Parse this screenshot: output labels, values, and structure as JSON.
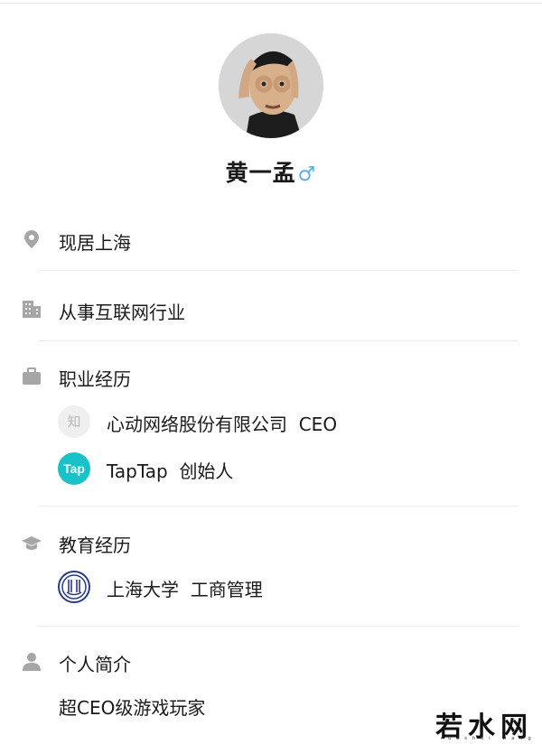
{
  "profile": {
    "name": "黄一孟",
    "gender_symbol": "♂"
  },
  "location": {
    "text": "现居上海",
    "icon": "location-pin-icon"
  },
  "industry": {
    "text": "从事互联网行业",
    "icon": "building-icon"
  },
  "career": {
    "title": "职业经历",
    "icon": "briefcase-icon",
    "items": [
      {
        "org": "心动网络股份有限公司",
        "role": "CEO",
        "logo_text": "知"
      },
      {
        "org": "TapTap",
        "role": "创始人",
        "logo_text": "Tap"
      }
    ]
  },
  "education": {
    "title": "教育经历",
    "icon": "graduation-cap-icon",
    "items": [
      {
        "school": "上海大学",
        "major": "工商管理"
      }
    ]
  },
  "bio": {
    "title": "个人简介",
    "icon": "person-icon",
    "text": "超CEO级游戏玩家"
  },
  "watermark": {
    "text": "若水网",
    "sub": "ruoshui wang"
  },
  "colors": {
    "gender": "#5ab0e6",
    "icon_gray": "#a6a6a6",
    "taptap": "#18c2c8",
    "divider": "#ececec"
  }
}
